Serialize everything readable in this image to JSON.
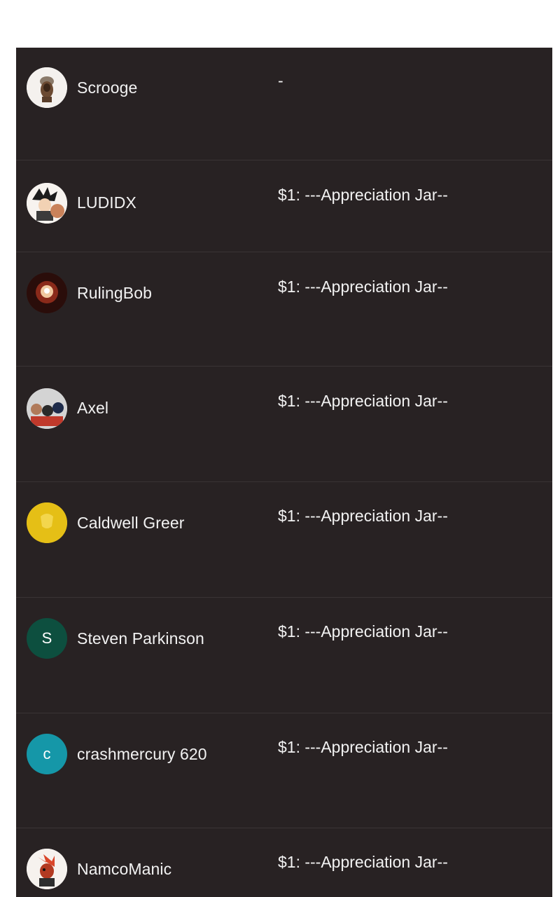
{
  "supporters": [
    {
      "name": "Scrooge",
      "tier": "-",
      "avatar": "photo-avatar-scrooge"
    },
    {
      "name": "LUDIDX",
      "tier": "$1: ---Appreciation Jar--",
      "avatar": "photo-avatar-ludidx"
    },
    {
      "name": "RulingBob",
      "tier": "$1: ---Appreciation Jar--",
      "avatar": "photo-avatar-rulingbob"
    },
    {
      "name": "Axel",
      "tier": "$1: ---Appreciation Jar--",
      "avatar": "photo-avatar-axel"
    },
    {
      "name": "Caldwell Greer",
      "tier": "$1: ---Appreciation Jar--",
      "avatar": "photo-avatar-caldwell",
      "color": "#e5bf16"
    },
    {
      "name": "Steven Parkinson",
      "tier": "$1: ---Appreciation Jar--",
      "avatar_letter": "S",
      "color": "#0d4f3f"
    },
    {
      "name": "crashmercury 620",
      "tier": "$1: ---Appreciation Jar--",
      "avatar_letter": "c",
      "color": "#1597a8"
    },
    {
      "name": "NamcoManic",
      "tier": "$1: ---Appreciation Jar--",
      "avatar": "photo-avatar-namcomanic"
    }
  ],
  "colors": {
    "panel_bg": "#282223",
    "divider": "#3a3435",
    "text": "#f2f2f2"
  }
}
